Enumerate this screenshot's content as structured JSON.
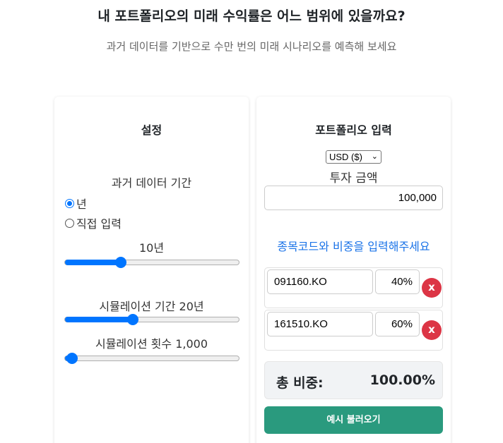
{
  "header": {
    "title": "내 포트폴리오의 미래 수익률은 어느 범위에 있을까요?",
    "subtitle": "과거 데이터를 기반으로 수만 번의 미래 시나리오를 예측해 보세요"
  },
  "settings": {
    "title": "설정",
    "history_label": "과거 데이터 기간",
    "radio_year": "년",
    "radio_custom": "직접 입력",
    "history_value": "10년",
    "history_slider": 0.32,
    "sim_period_label": "시뮬레이션 기간 20년",
    "sim_period_slider": 0.39,
    "sim_count_label": "시뮬레이션 횟수 1,000",
    "sim_count_slider": 0.04
  },
  "portfolio": {
    "title": "포트폴리오 입력",
    "currency": "USD ($)",
    "amount_label": "투자 금액",
    "amount_value": "100,000",
    "stock_prompt": "종목코드와 비중을 입력해주세요",
    "stocks": [
      {
        "code": "091160.KO",
        "weight": "40%",
        "remove": "x"
      },
      {
        "code": "161510.KO",
        "weight": "60%",
        "remove": "x"
      }
    ],
    "total_label": "총 비중:",
    "total_value": "100.00%",
    "example_button": "예시 불러오기"
  },
  "colors": {
    "accent": "#0075ff",
    "link": "#1a73e8",
    "danger": "#dc3545",
    "primary_button": "#2a9a7e"
  }
}
